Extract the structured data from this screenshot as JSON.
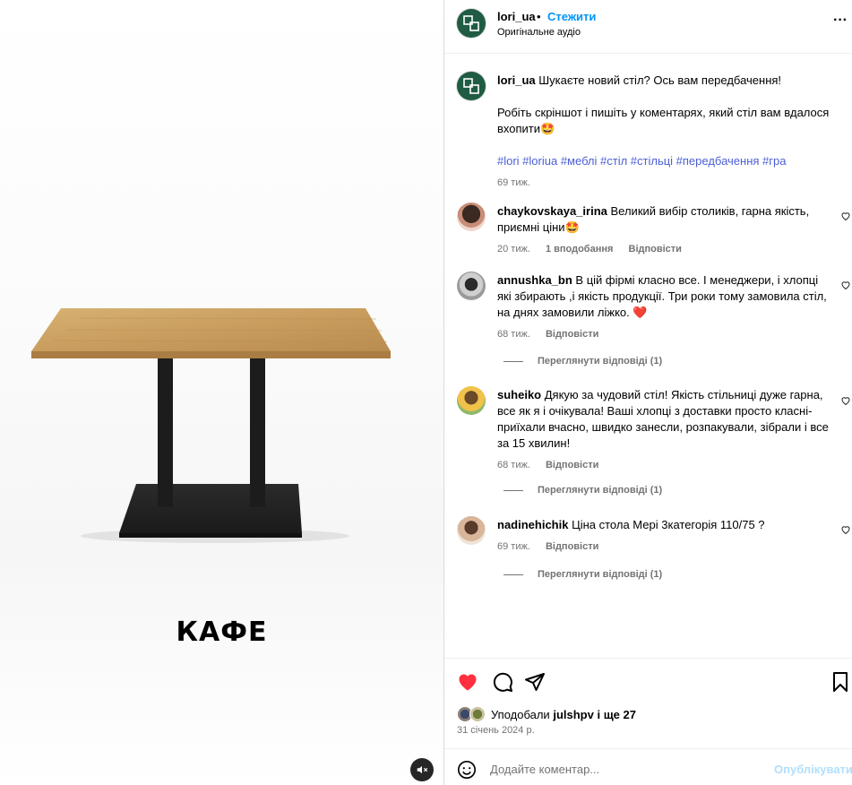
{
  "media": {
    "product_name": "КАФЕ",
    "mute_icon": "speaker-muted-icon"
  },
  "header": {
    "username": "lori_ua",
    "separator": "•",
    "follow_label": "Стежити",
    "audio_label": "Оригінальне аудіо",
    "more_label": "···"
  },
  "caption": {
    "username": "lori_ua",
    "text_line1": "Шукаєте новий стіл? Ось вам передбачення!",
    "text_line2": "Робіть скріншот і пишіть у коментарях, який стіл вам вдалося вхопити",
    "emoji": "🤩",
    "hashtags": "#lori #loriua #меблі #стіл #стільці #передбачення #гра",
    "time": "69 тиж."
  },
  "comments": [
    {
      "username": "chaykovskaya_irina",
      "text": "Великий вибір столиків, гарна якість, приємні ціни",
      "emoji": "🤩",
      "time": "20 тиж.",
      "likes": "1 вподобання",
      "reply": "Відповісти"
    },
    {
      "username": "annushka_bn",
      "text": "В цій фірмі класно все. І менеджери, і хлопці які збирають ,і якість продукції. Три роки тому замовила стіл, на днях замовили ліжко.",
      "emoji": "❤️",
      "time": "68 тиж.",
      "reply": "Відповісти",
      "view_replies": "Переглянути відповіді (1)"
    },
    {
      "username": "suheiko",
      "text": "Дякую за чудовий стіл! Якість стільниці дуже гарна, все як я і очікувала! Ваші хлопці з доставки просто класні- приїхали вчасно, швидко занесли, розпакували, зібрали і все за 15 хвилин!",
      "time": "68 тиж.",
      "reply": "Відповісти",
      "view_replies": "Переглянути відповіді (1)"
    },
    {
      "username": "nadinehichik",
      "text": "Ціна стола Мері 3категорія 110/75 ?",
      "time": "69 тиж.",
      "reply": "Відповісти",
      "view_replies": "Переглянути відповіді (1)"
    }
  ],
  "actions": {
    "liked_by_prefix": "Уподобали",
    "liked_by_user": "julshpv",
    "liked_by_suffix": "і ще 27",
    "date": "31 січень 2024 р."
  },
  "add_comment": {
    "placeholder": "Додайте коментар...",
    "post_label": "Опублікувати"
  },
  "colors": {
    "brand_green": "#1f5c43",
    "link_blue": "#0095f6",
    "hashtag_blue": "#4a5fd6",
    "like_red": "#ff3040",
    "muted_text": "#737373"
  }
}
